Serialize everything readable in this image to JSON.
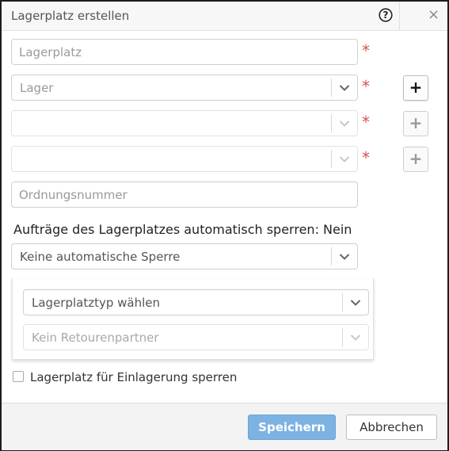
{
  "dialog": {
    "title": "Lagerplatz erstellen"
  },
  "fields": {
    "lagerplatz": {
      "placeholder": "Lagerplatz",
      "value": ""
    },
    "lager": {
      "placeholder": "Lager"
    },
    "select3": {
      "value": ""
    },
    "select4": {
      "value": ""
    },
    "ordnungsnummer": {
      "placeholder": "Ordnungsnummer",
      "value": ""
    },
    "required_mark": "*"
  },
  "lock": {
    "label": "Aufträge des Lagerplatzes automatisch sperren: Nein",
    "selected": "Keine automatische Sperre"
  },
  "panel": {
    "type_select": "Lagerplatztyp wählen",
    "return_partner": "Kein Retourenpartner"
  },
  "checkbox": {
    "label": "Lagerplatz für Einlagerung sperren",
    "checked": false
  },
  "buttons": {
    "plus": "+",
    "save": "Speichern",
    "cancel": "Abbrechen"
  },
  "icons": {
    "help": "help-icon",
    "close": "close-icon",
    "chevron": "chevron-down-icon",
    "close_glyph": "×"
  },
  "colors": {
    "primary_button": "#7db3e3",
    "required": "#d9534f"
  }
}
